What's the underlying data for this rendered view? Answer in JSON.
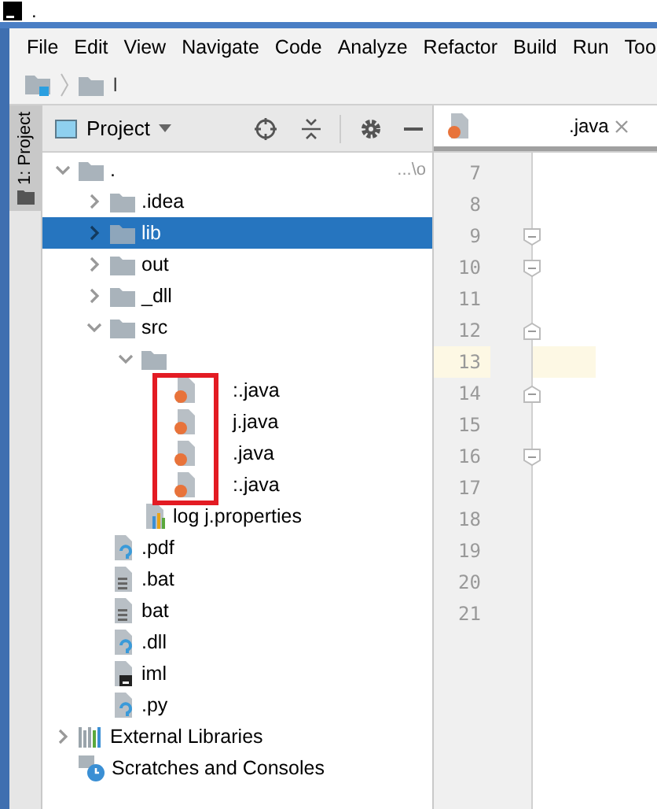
{
  "window": {
    "title": "."
  },
  "menu": [
    "File",
    "Edit",
    "View",
    "Navigate",
    "Code",
    "Analyze",
    "Refactor",
    "Build",
    "Run",
    "Too"
  ],
  "breadcrumb": [
    {
      "kind": "project"
    },
    {
      "kind": "folder",
      "label": "l"
    }
  ],
  "tool_strip": {
    "label": "1: Project"
  },
  "project_panel": {
    "title": "Project"
  },
  "tree": [
    {
      "kind": "folder",
      "label": ".",
      "hint": "...\\o",
      "expanded": true,
      "selected": false,
      "children": [
        {
          "kind": "folder",
          "label": ".idea",
          "expanded": false,
          "selected": false
        },
        {
          "kind": "folder",
          "label": "lib",
          "expanded": false,
          "selected": true
        },
        {
          "kind": "folder",
          "label": "out",
          "expanded": false,
          "selected": false
        },
        {
          "kind": "folder",
          "label": "_dll",
          "expanded": false,
          "selected": false
        },
        {
          "kind": "folder",
          "label": "src",
          "expanded": true,
          "selected": false,
          "children": [
            {
              "kind": "folder",
              "expanded": true,
              "selected": false,
              "children": [
                {
                  "kind": "java",
                  "label": ":.java",
                  "selected": false
                },
                {
                  "kind": "java",
                  "label": "j.java",
                  "selected": false
                },
                {
                  "kind": "java",
                  "label": ".java",
                  "selected": false
                },
                {
                  "kind": "java",
                  "label": ":.java",
                  "selected": false
                }
              ]
            },
            {
              "kind": "properties",
              "label": "log j.properties",
              "selected": false
            }
          ]
        },
        {
          "kind": "unknown",
          "label": ".pdf",
          "selected": false
        },
        {
          "kind": "text",
          "label": ".bat",
          "selected": false
        },
        {
          "kind": "text",
          "label": "bat",
          "selected": false
        },
        {
          "kind": "unknown",
          "label": ".dll",
          "selected": false
        },
        {
          "kind": "module",
          "label": "iml",
          "selected": false
        },
        {
          "kind": "unknown",
          "label": ".py",
          "selected": false
        }
      ]
    },
    {
      "kind": "libraries",
      "label": "External Libraries",
      "expanded": false,
      "selected": false
    },
    {
      "kind": "scratches",
      "label": "Scratches and Consoles",
      "selected": false
    }
  ],
  "editor": {
    "tab": {
      "label": ".java"
    },
    "lines": [
      {
        "number": "7",
        "kind": "plain",
        "current": false
      },
      {
        "number": "8",
        "kind": "plain",
        "current": false
      },
      {
        "number": "9",
        "kind": "fold_start",
        "current": false
      },
      {
        "number": "10",
        "kind": "fold_start",
        "current": false
      },
      {
        "number": "11",
        "kind": "plain",
        "current": false
      },
      {
        "number": "12",
        "kind": "fold_end",
        "current": false
      },
      {
        "number": "13",
        "kind": "plain",
        "current": true
      },
      {
        "number": "14",
        "kind": "fold_end",
        "current": false
      },
      {
        "number": "15",
        "kind": "plain",
        "current": false
      },
      {
        "number": "16",
        "kind": "fold_start",
        "current": false
      },
      {
        "number": "17",
        "kind": "plain",
        "current": false
      },
      {
        "number": "18",
        "kind": "plain",
        "current": false
      },
      {
        "number": "19",
        "kind": "plain",
        "current": false
      },
      {
        "number": "20",
        "kind": "plain",
        "current": false
      },
      {
        "number": "21",
        "kind": "plain",
        "current": false
      }
    ]
  }
}
